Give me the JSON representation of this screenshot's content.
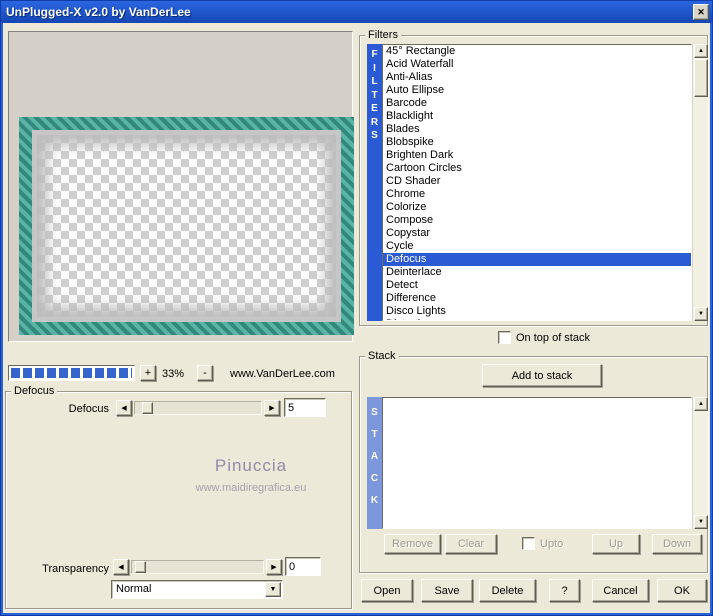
{
  "window": {
    "title": "UnPlugged-X v2.0 by VanDerLee",
    "close": "✕"
  },
  "preview": {
    "zoom_in": "+",
    "zoom_level": "33%",
    "zoom_out": "-",
    "website": "www.VanDerLee.com"
  },
  "params": {
    "group_label": "Defocus",
    "defocus": {
      "label": "Defocus",
      "value": "5"
    },
    "transparency": {
      "label": "Transparency",
      "value": "0"
    },
    "blend_mode": "Normal",
    "watermark": {
      "name": "Pinuccia",
      "url": "www.maidiregrafica.eu"
    }
  },
  "filters": {
    "group_label": "Filters",
    "vertical_label": "FILTERS",
    "selected": "Defocus",
    "on_top_label": "On top of stack",
    "on_top_checked": false,
    "items": [
      "45° Rectangle",
      "Acid Waterfall",
      "Anti-Alias",
      "Auto Ellipse",
      "Barcode",
      "Blacklight",
      "Blades",
      "Blobspike",
      "Brighten Dark",
      "Cartoon Circles",
      "CD Shader",
      "Chrome",
      "Colorize",
      "Compose",
      "Copystar",
      "Cycle",
      "Defocus",
      "Deinterlace",
      "Detect",
      "Difference",
      "Disco Lights",
      "Distortion"
    ]
  },
  "stack": {
    "group_label": "Stack",
    "vertical_label": "STACK",
    "add_button": "Add to stack",
    "items": [],
    "remove_button": "Remove",
    "clear_button": "Clear",
    "upto_label": "Upto",
    "upto_checked": false,
    "up_button": "Up",
    "down_button": "Down"
  },
  "actions": {
    "open": "Open",
    "save": "Save",
    "delete": "Delete",
    "help": "?",
    "cancel": "Cancel",
    "ok": "OK"
  },
  "icons": {
    "left": "◀",
    "right": "▶",
    "up": "▲",
    "down": "▼"
  },
  "colors": {
    "selection": "#2a5ad4",
    "stack_bar": "#7d97dd",
    "teal_frame": "#3e9e90",
    "progress": "#3464cc",
    "titlebar_top": "#2a66e0",
    "titlebar_bottom": "#1546b4"
  }
}
